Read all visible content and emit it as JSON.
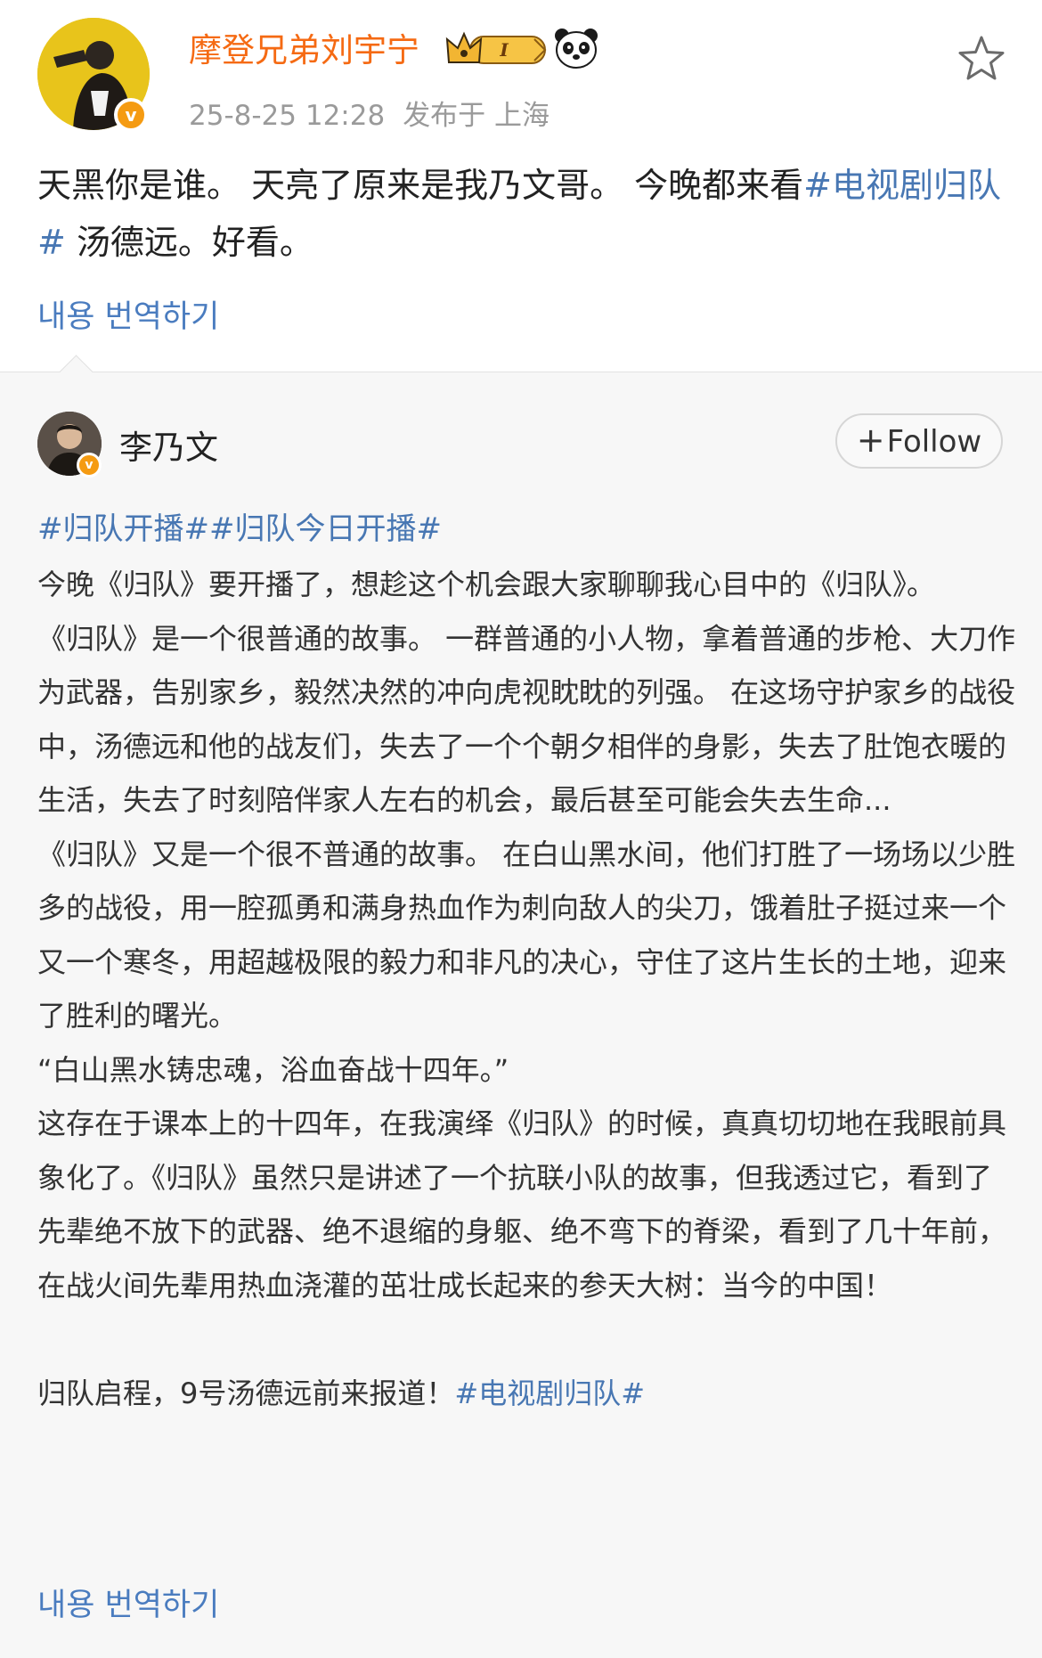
{
  "post": {
    "author": "摩登兄弟刘宇宁",
    "badge_level": "I",
    "timestamp": "25-8-25 12:28",
    "location": "发布于 上海",
    "text_plain": "天黑你是谁。 天亮了原来是我乃文哥。 今晚都来看",
    "text_hashtag": "#电视剧归队#",
    "text_end": " 汤德远。好看。",
    "translate_label": "내용 번역하기"
  },
  "repost": {
    "author": "李乃文",
    "follow_label": "Follow",
    "hashtags": "#归队开播##归队今日开播#",
    "paragraphs": [
      "今晚《归队》要开播了，想趁这个机会跟大家聊聊我心目中的《归队》。",
      "《归队》是一个很普通的故事。 一群普通的小人物，拿着普通的步枪、大刀作为武器，告别家乡，毅然决然的冲向虎视眈眈的列强。 在这场守护家乡的战役中，汤德远和他的战友们，失去了一个个朝夕相伴的身影，失去了肚饱衣暖的生活，失去了时刻陪伴家人左右的机会，最后甚至可能会失去生命...",
      "《归队》又是一个很不普通的故事。 在白山黑水间，他们打胜了一场场以少胜多的战役，用一腔孤勇和满身热血作为刺向敌人的尖刀，饿着肚子挺过来一个又一个寒冬，用超越极限的毅力和非凡的决心，守住了这片生长的土地，迎来了胜利的曙光。",
      "“白山黑水铸忠魂，浴血奋战十四年。”",
      "这存在于课本上的十四年，在我演绎《归队》的时候，真真切切地在我眼前具象化了。《归队》虽然只是讲述了一个抗联小队的故事，但我透过它，看到了先辈绝不放下的武器、绝不退缩的身躯、绝不弯下的脊梁，看到了几十年前，在战火间先辈用热血浇灌的茁壮成长起来的参天大树：当今的中国！"
    ],
    "closing_plain": "归队启程，9号汤德远前来报道！",
    "closing_hashtag": "#电视剧归队#",
    "translate_label": "내용 번역하기"
  },
  "colors": {
    "author_orange": "#f56a13",
    "hashtag_blue": "#4877b3",
    "link_blue": "#4a7cbf",
    "meta_gray": "#9a9a9a",
    "repost_bg": "#f7f7f7"
  },
  "icons": {
    "verified": "verified-v-icon",
    "level_badge": "crown-level-badge-icon",
    "panda": "panda-icon",
    "favorite": "star-outline-icon"
  }
}
